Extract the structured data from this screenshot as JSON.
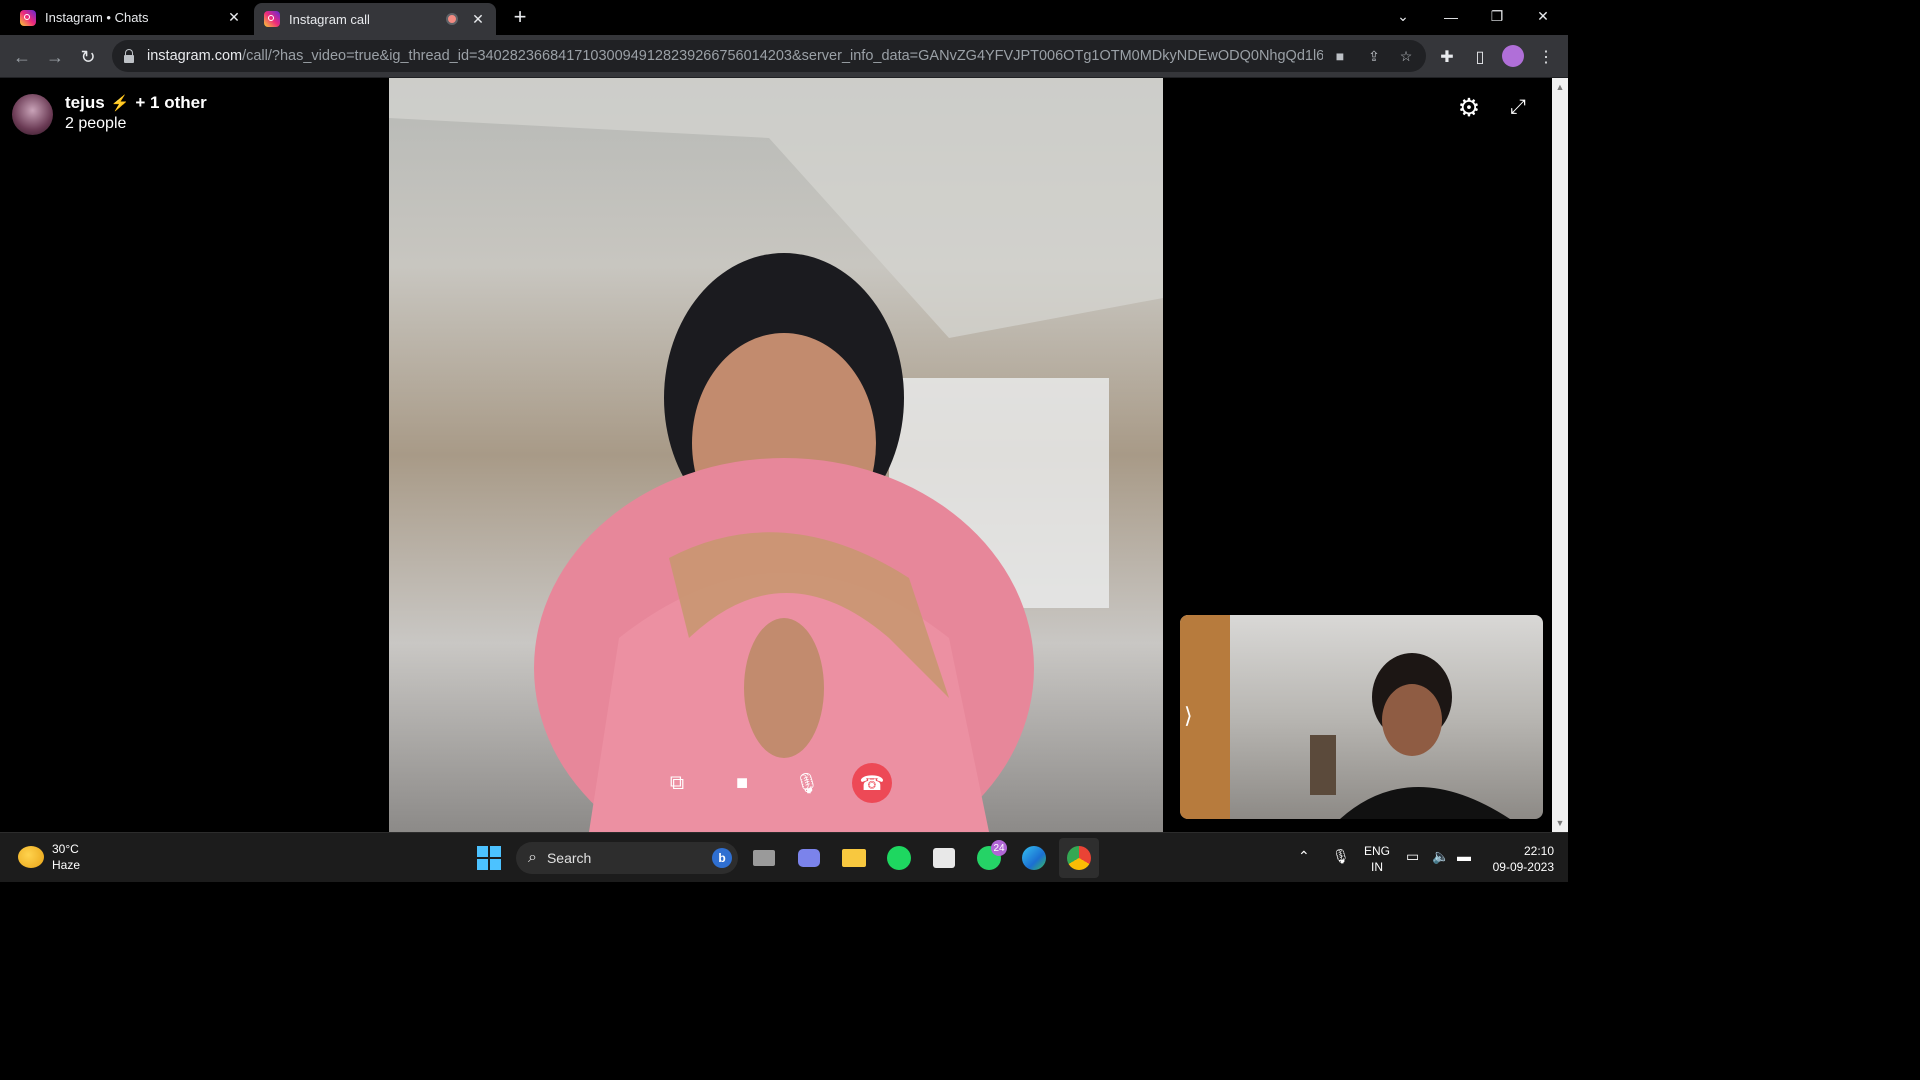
{
  "browser": {
    "tabs": [
      {
        "title": "Instagram • Chats"
      },
      {
        "title": "Instagram call"
      }
    ],
    "url_host": "instagram.com",
    "url_path": "/call/?has_video=true&ig_thread_id=340282366841710300949128239266756014203&server_info_data=GANvZG4YFVJPT006OTg1OTM0MDkyNDEwODQ0NhgQd1l6YkRld..."
  },
  "call": {
    "name": "tejus",
    "extra": "+ 1 other",
    "people": "2 people"
  },
  "taskbar": {
    "weather_temp": "30°C",
    "weather_desc": "Haze",
    "search_label": "Search",
    "whatsapp_badge": "24",
    "lang_line1": "ENG",
    "lang_line2": "IN",
    "time": "22:10",
    "date": "09-09-2023"
  },
  "colors": {
    "end_call": "#ed4956",
    "instagram_accent": "#ee2a7b",
    "windows_accent": "#4cc2ff"
  },
  "icons": [
    "instagram-icon",
    "close-icon",
    "recording-icon",
    "plus-icon",
    "back-icon",
    "forward-icon",
    "reload-icon",
    "lock-icon",
    "camera-icon",
    "share-icon",
    "star-icon",
    "extensions-icon",
    "sidepanel-icon",
    "menu-icon",
    "gear-icon",
    "expand-icon",
    "screen-share-icon",
    "video-icon",
    "mic-icon",
    "end-call-icon",
    "windows-icon",
    "search-icon",
    "whatsapp-icon",
    "chrome-icon"
  ]
}
